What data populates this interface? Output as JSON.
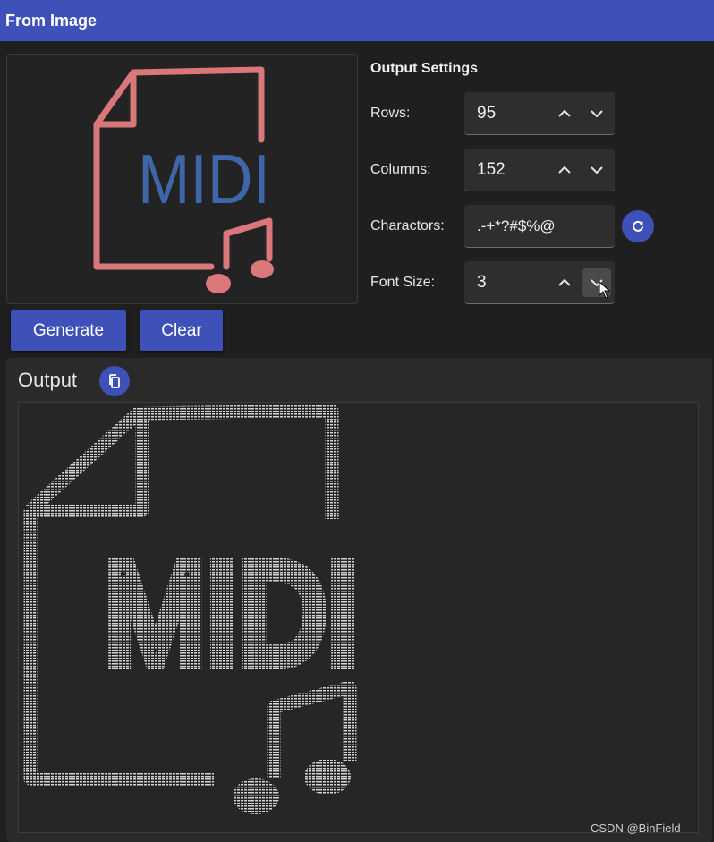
{
  "window": {
    "title": "From Image"
  },
  "preview": {
    "logo_text": "MIDI",
    "colors": {
      "outline": "#d9777b",
      "text": "#3f66a9"
    }
  },
  "settings": {
    "title": "Output Settings",
    "rows": {
      "label": "Rows:",
      "value": "95"
    },
    "columns": {
      "label": "Columns:",
      "value": "152"
    },
    "characters": {
      "label": "Charactors:",
      "value": ".-+*?#$%@"
    },
    "font_size": {
      "label": "Font Size:",
      "value": "3"
    }
  },
  "actions": {
    "generate": "Generate",
    "clear": "Clear"
  },
  "output": {
    "label": "Output",
    "ascii_text": "MIDI"
  },
  "watermark": "CSDN @BinField",
  "colors": {
    "accent": "#3d51b8",
    "background": "#1f1f1f"
  }
}
